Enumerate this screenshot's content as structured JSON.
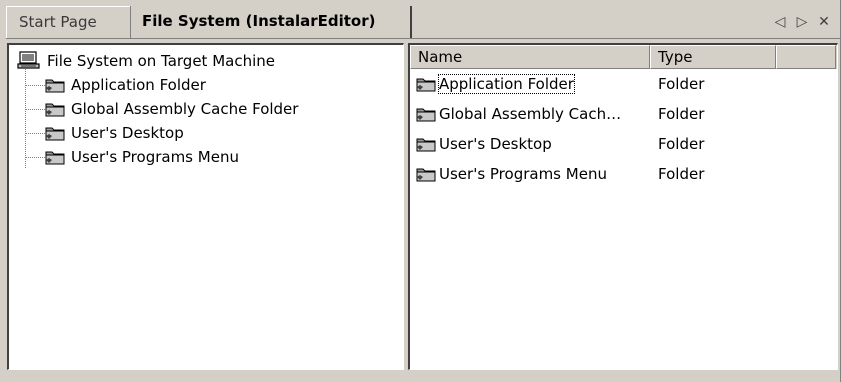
{
  "tabs": {
    "start_page": "Start Page",
    "file_system": "File System (InstalarEditor)",
    "controls": {
      "prev": "◁",
      "next": "▷",
      "close": "✕"
    }
  },
  "tree": {
    "root": {
      "label": "File System on Target Machine",
      "icon": "computer-icon"
    },
    "items": [
      {
        "label": "Application Folder",
        "icon": "special-folder-icon"
      },
      {
        "label": "Global Assembly Cache Folder",
        "icon": "special-folder-icon"
      },
      {
        "label": "User's Desktop",
        "icon": "special-folder-icon"
      },
      {
        "label": "User's Programs Menu",
        "icon": "special-folder-icon"
      }
    ]
  },
  "list": {
    "columns": [
      "Name",
      "Type",
      ""
    ],
    "rows": [
      {
        "name": "Application Folder",
        "type": "Folder",
        "icon": "special-folder-icon",
        "focused": true
      },
      {
        "name": "Global Assembly Cach…",
        "type": "Folder",
        "icon": "special-folder-icon",
        "focused": false
      },
      {
        "name": "User's Desktop",
        "type": "Folder",
        "icon": "special-folder-icon",
        "focused": false
      },
      {
        "name": "User's Programs Menu",
        "type": "Folder",
        "icon": "special-folder-icon",
        "focused": false
      }
    ]
  },
  "colors": {
    "chrome": "#d4d0c8",
    "pane_background": "#ffffff",
    "shadow": "#808080",
    "folder": "#808080"
  }
}
